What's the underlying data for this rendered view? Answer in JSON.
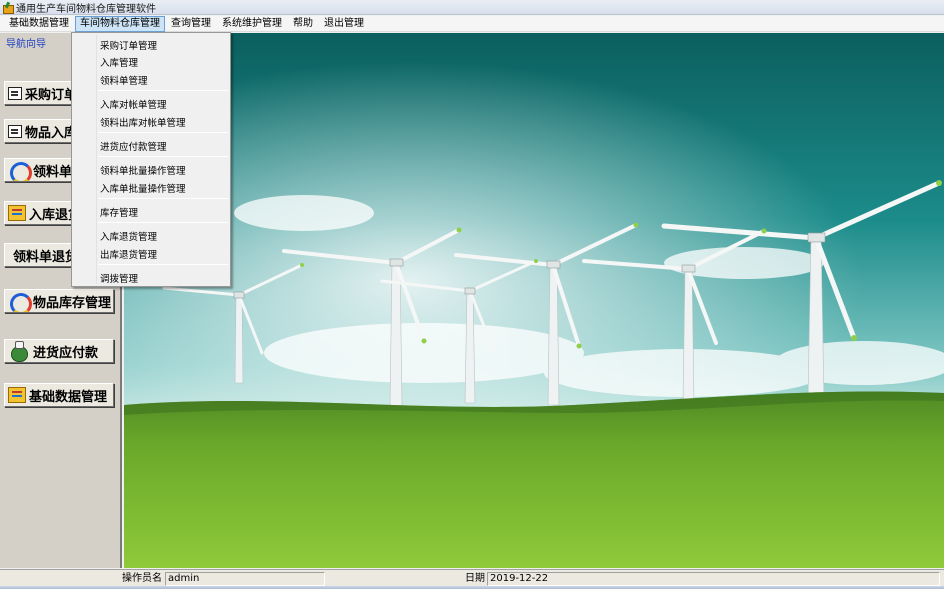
{
  "window": {
    "title": "通用生产车间物料仓库管理软件"
  },
  "menubar": {
    "items": [
      {
        "label": "基础数据管理"
      },
      {
        "label": "车间物料仓库管理",
        "active": true
      },
      {
        "label": "查询管理"
      },
      {
        "label": "系统维护管理"
      },
      {
        "label": "帮助"
      },
      {
        "label": "退出管理"
      }
    ]
  },
  "dropdown": {
    "items": [
      "采购订单管理",
      "入库管理",
      "领料单管理",
      "入库对帐单管理",
      "领料出库对帐单管理",
      "进货应付款管理",
      "领料单批量操作管理",
      "入库单批量操作管理",
      "库存管理",
      "入库退货管理",
      "出库退货管理",
      "调拨管理"
    ]
  },
  "navpanel": {
    "title": "导航向导",
    "buttons": [
      {
        "label": "采购订单",
        "icon": "document-icon"
      },
      {
        "label": "物品入库",
        "icon": "document-icon"
      },
      {
        "label": "领料单",
        "icon": "cycle-arrows-icon"
      },
      {
        "label": "入库退货",
        "icon": "folder-icon"
      },
      {
        "label": "领料单退货",
        "icon": ""
      },
      {
        "label": "物品库存管理",
        "icon": "cycle-arrows-icon"
      },
      {
        "label": "进货应付款",
        "icon": "money-bag-icon"
      },
      {
        "label": "基础数据管理",
        "icon": "folder-icon"
      }
    ]
  },
  "statusbar": {
    "operator_label": "操作员名",
    "operator_value": "admin",
    "date_label": "日期",
    "date_value": "2019-12-22"
  },
  "colors": {
    "nav_title": "#1f3fc0",
    "menu_active_bg": "#cde4f7",
    "sky_top": "#0f6f6c",
    "grass": "#6aa82a"
  }
}
